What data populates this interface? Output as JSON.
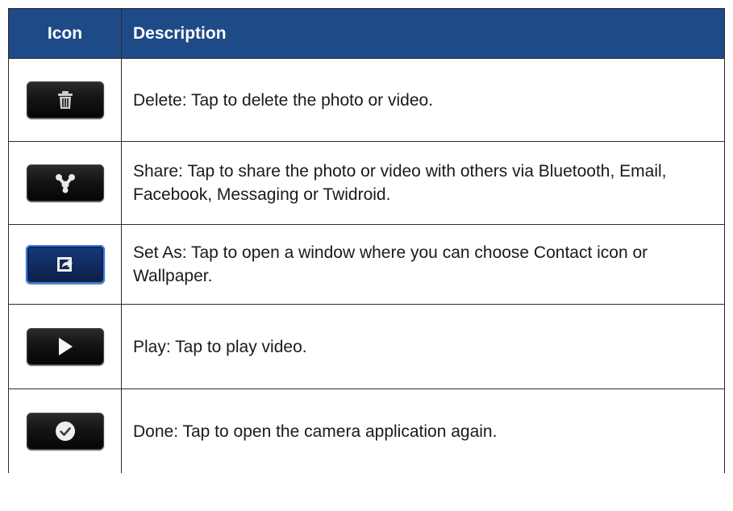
{
  "table": {
    "headers": {
      "icon": "Icon",
      "description": "Description"
    },
    "rows": [
      {
        "icon": "trash-icon",
        "description": "Delete: Tap to delete the photo or video."
      },
      {
        "icon": "share-icon",
        "description": "Share: Tap to share the photo or video with others via Bluetooth, Email, Facebook, Messaging or Twidroid."
      },
      {
        "icon": "set-as-icon",
        "description": "Set As: Tap to open a window where you can choose Contact icon or Wallpaper."
      },
      {
        "icon": "play-icon",
        "description": "Play: Tap to play video."
      },
      {
        "icon": "done-check-icon",
        "description": "Done: Tap to open the camera application again."
      }
    ]
  },
  "colors": {
    "header_background": "#1e4a87",
    "header_text": "#ffffff",
    "border": "#2b2b2b",
    "button_dark": "#111111",
    "button_blue_frame": "#3a79e0"
  }
}
